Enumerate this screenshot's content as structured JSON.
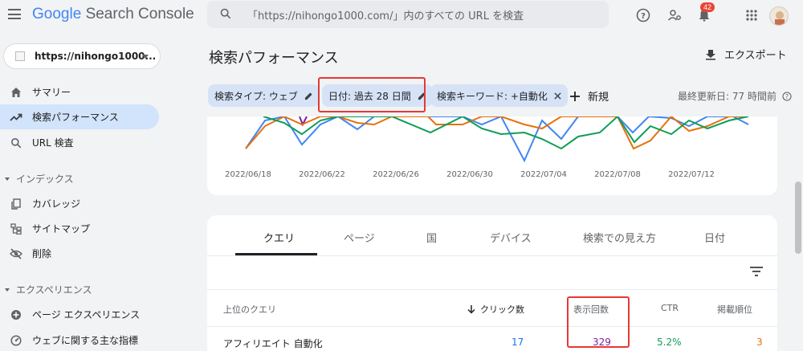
{
  "app": {
    "logo_google": "Google",
    "logo_product": "Search Console"
  },
  "search": {
    "placeholder": "「https://nihongo1000.com/」内のすべての URL を検査"
  },
  "header": {
    "notification_count": "42"
  },
  "property": {
    "label": "https://nihongo1000..."
  },
  "sidebar": {
    "items": [
      {
        "label": "サマリー",
        "icon": "home-icon"
      },
      {
        "label": "検索パフォーマンス",
        "icon": "trending-up-icon",
        "active": true
      },
      {
        "label": "URL 検査",
        "icon": "search-icon"
      }
    ],
    "index_section": "インデックス",
    "index_items": [
      {
        "label": "カバレッジ",
        "icon": "copy-icon"
      },
      {
        "label": "サイトマップ",
        "icon": "sitemap-icon"
      },
      {
        "label": "削除",
        "icon": "eye-off-icon"
      }
    ],
    "experience_section": "エクスペリエンス",
    "experience_items": [
      {
        "label": "ページ エクスペリエンス",
        "icon": "add-circle-icon"
      },
      {
        "label": "ウェブに関する主な指標",
        "icon": "gauge-icon"
      }
    ]
  },
  "main": {
    "title": "検索パフォーマンス",
    "export_label": "エクスポート",
    "filters": [
      {
        "label": "検索タイプ: ウェブ"
      },
      {
        "label": "日付: 過去 28 日間"
      },
      {
        "label": "検索キーワード: +自動化"
      }
    ],
    "add_new_label": "新規",
    "last_updated": "最終更新日: 77 時間前"
  },
  "chart_data": {
    "type": "line",
    "x_tick_labels": [
      "2022/06/18",
      "2022/06/22",
      "2022/06/26",
      "2022/06/30",
      "2022/07/04",
      "2022/07/08",
      "2022/07/12"
    ],
    "series_colors": [
      "#4285f4",
      "#7b1fa2",
      "#e8710a",
      "#0f9d58"
    ]
  },
  "tabs": [
    {
      "label": "クエリ",
      "active": true
    },
    {
      "label": "ページ"
    },
    {
      "label": "国"
    },
    {
      "label": "デバイス"
    },
    {
      "label": "検索での見え方"
    },
    {
      "label": "日付"
    }
  ],
  "table": {
    "columns": [
      "上位のクエリ",
      "クリック数",
      "表示回数",
      "CTR",
      "掲載順位"
    ],
    "rows": [
      {
        "query": "アフィリエイト 自動化",
        "clicks": "17",
        "impressions": "329",
        "ctr": "5.2%",
        "position": "3"
      }
    ]
  },
  "colors": {
    "clicks": "#1a73e8",
    "impressions": "#7b1fa2",
    "ctr": "#0f9d58",
    "position": "#e8710a",
    "highlight": "#e53935"
  }
}
